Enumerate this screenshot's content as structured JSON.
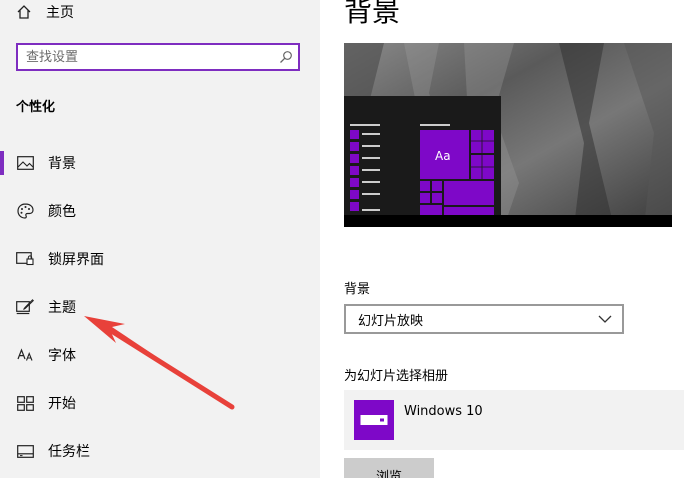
{
  "sidebar": {
    "home_label": "主页",
    "search_placeholder": "查找设置",
    "section_heading": "个性化",
    "items": [
      {
        "label": "背景",
        "icon": "picture-icon",
        "selected": true
      },
      {
        "label": "颜色",
        "icon": "palette-icon",
        "selected": false
      },
      {
        "label": "锁屏界面",
        "icon": "lock-screen-icon",
        "selected": false
      },
      {
        "label": "主题",
        "icon": "theme-brush-icon",
        "selected": false
      },
      {
        "label": "字体",
        "icon": "font-icon",
        "selected": false
      },
      {
        "label": "开始",
        "icon": "start-grid-icon",
        "selected": false
      },
      {
        "label": "任务栏",
        "icon": "taskbar-icon",
        "selected": false
      }
    ]
  },
  "main": {
    "title": "背景",
    "preview": {
      "tile_text": "Aa"
    },
    "background_label": "背景",
    "background_value": "幻灯片放映",
    "album_label": "为幻灯片选择相册",
    "album_name": "Windows 10",
    "browse_label": "浏览"
  },
  "colors": {
    "accent": "#7e2dc0",
    "tile": "#7e08c8",
    "sidebar_bg": "#f2f2f2",
    "annotation_arrow": "#e8413a"
  }
}
